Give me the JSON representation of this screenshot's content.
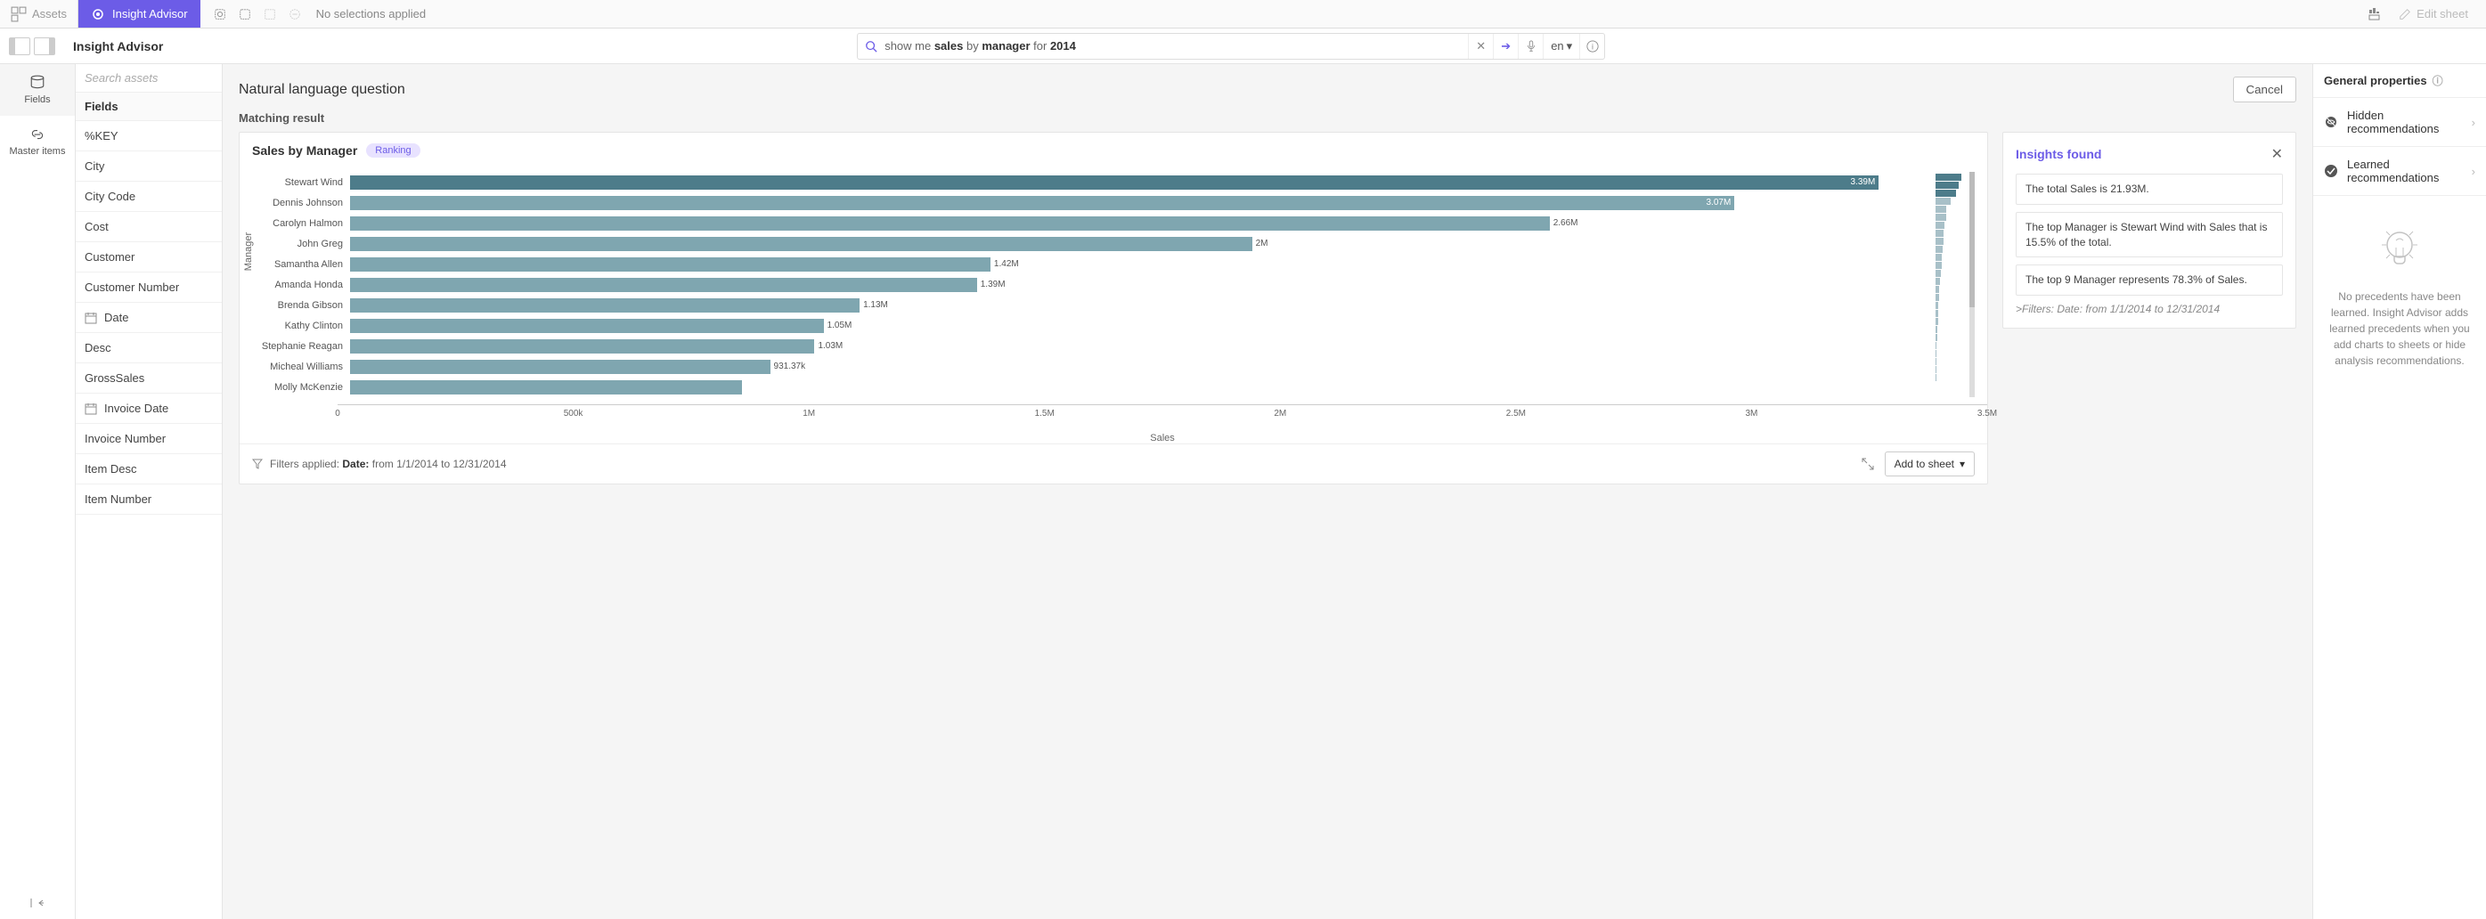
{
  "topbar": {
    "assets": "Assets",
    "insight_tab": "Insight Advisor",
    "no_selections": "No selections applied",
    "edit_sheet": "Edit sheet"
  },
  "header": {
    "title": "Insight Advisor",
    "search_prefix": "show me ",
    "search_b1": "sales",
    "search_mid": " by ",
    "search_b2": "manager",
    "search_mid2": " for ",
    "search_b3": "2014",
    "lang": "en"
  },
  "rail": {
    "fields": "Fields",
    "master": "Master items"
  },
  "fields_panel": {
    "search_placeholder": "Search assets",
    "header": "Fields",
    "items": [
      "%KEY",
      "City",
      "City Code",
      "Cost",
      "Customer",
      "Customer Number",
      "Date",
      "Desc",
      "GrossSales",
      "Invoice Date",
      "Invoice Number",
      "Item Desc",
      "Item Number"
    ]
  },
  "content": {
    "nlq_title": "Natural language question",
    "cancel": "Cancel",
    "matching": "Matching result"
  },
  "chart": {
    "title": "Sales by Manager",
    "badge": "Ranking",
    "ylabel": "Manager",
    "xlabel": "Sales",
    "filters_label": "Filters applied:",
    "filters_field": "Date:",
    "filters_range": "from 1/1/2014 to 12/31/2014",
    "add_to_sheet": "Add to sheet",
    "xticks": [
      "0",
      "500k",
      "1M",
      "1.5M",
      "2M",
      "2.5M",
      "3M",
      "3.5M"
    ]
  },
  "chart_data": {
    "type": "bar",
    "orientation": "horizontal",
    "title": "Sales by Manager",
    "xlabel": "Sales",
    "ylabel": "Manager",
    "xlim": [
      0,
      3500000
    ],
    "categories": [
      "Stewart Wind",
      "Dennis Johnson",
      "Carolyn Halmon",
      "John Greg",
      "Samantha Allen",
      "Amanda Honda",
      "Brenda Gibson",
      "Kathy Clinton",
      "Stephanie Reagan",
      "Micheal Williams",
      "Molly McKenzie"
    ],
    "values": [
      3390000,
      3070000,
      2660000,
      2000000,
      1420000,
      1390000,
      1130000,
      1050000,
      1030000,
      931370,
      870000
    ],
    "value_labels": [
      "3.39M",
      "3.07M",
      "2.66M",
      "2M",
      "1.42M",
      "1.39M",
      "1.13M",
      "1.05M",
      "1.03M",
      "931.37k",
      ""
    ]
  },
  "insights": {
    "title": "Insights found",
    "items": [
      "The total Sales is 21.93M.",
      "The top Manager is Stewart Wind with Sales that is 15.5% of the total.",
      "The top 9 Manager represents 78.3% of Sales."
    ],
    "filters": ">Filters: Date: from 1/1/2014 to 12/31/2014"
  },
  "right_panel": {
    "header": "General properties",
    "hidden": "Hidden recommendations",
    "learned": "Learned recommendations",
    "empty": "No precedents have been learned. Insight Advisor adds learned precedents when you add charts to sheets or hide analysis recommendations."
  }
}
